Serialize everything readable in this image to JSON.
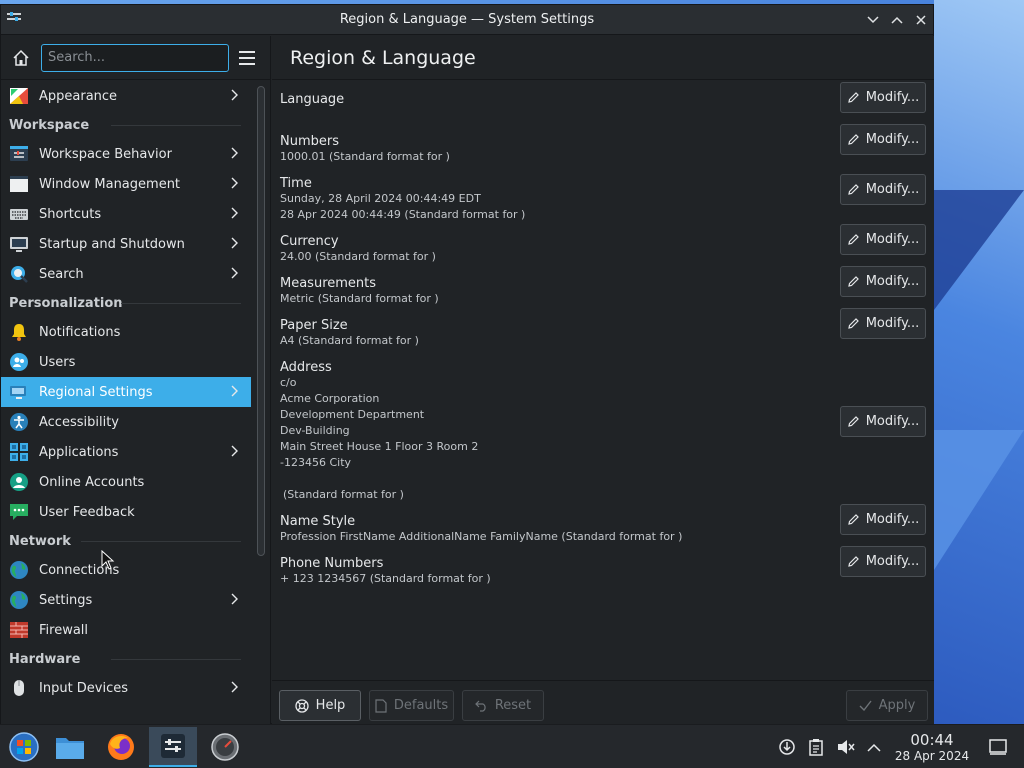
{
  "window": {
    "title": "Region & Language — System Settings"
  },
  "sidebar": {
    "search_placeholder": "Search...",
    "items": [
      {
        "type": "item",
        "label": "Appearance",
        "icon": "appearance-icon",
        "chevron": true
      },
      {
        "type": "heading",
        "label": "Workspace"
      },
      {
        "type": "item",
        "label": "Workspace Behavior",
        "icon": "workspace-behavior-icon",
        "chevron": true
      },
      {
        "type": "item",
        "label": "Window Management",
        "icon": "window-management-icon",
        "chevron": true
      },
      {
        "type": "item",
        "label": "Shortcuts",
        "icon": "keyboard-icon",
        "chevron": true
      },
      {
        "type": "item",
        "label": "Startup and Shutdown",
        "icon": "startup-icon",
        "chevron": true
      },
      {
        "type": "item",
        "label": "Search",
        "icon": "search-icon",
        "chevron": true
      },
      {
        "type": "heading",
        "label": "Personalization"
      },
      {
        "type": "item",
        "label": "Notifications",
        "icon": "bell-icon",
        "chevron": false
      },
      {
        "type": "item",
        "label": "Users",
        "icon": "users-icon",
        "chevron": false
      },
      {
        "type": "item",
        "label": "Regional Settings",
        "icon": "regional-icon",
        "chevron": true,
        "active": true
      },
      {
        "type": "item",
        "label": "Accessibility",
        "icon": "accessibility-icon",
        "chevron": false
      },
      {
        "type": "item",
        "label": "Applications",
        "icon": "applications-icon",
        "chevron": true
      },
      {
        "type": "item",
        "label": "Online Accounts",
        "icon": "online-accounts-icon",
        "chevron": false
      },
      {
        "type": "item",
        "label": "User Feedback",
        "icon": "feedback-icon",
        "chevron": false
      },
      {
        "type": "heading",
        "label": "Network"
      },
      {
        "type": "item",
        "label": "Connections",
        "icon": "globe-icon",
        "chevron": false
      },
      {
        "type": "item",
        "label": "Settings",
        "icon": "globe-icon",
        "chevron": true
      },
      {
        "type": "item",
        "label": "Firewall",
        "icon": "firewall-icon",
        "chevron": false
      },
      {
        "type": "heading",
        "label": "Hardware"
      },
      {
        "type": "item",
        "label": "Input Devices",
        "icon": "mouse-icon",
        "chevron": true
      }
    ]
  },
  "main": {
    "title": "Region & Language",
    "modify_label": "Modify...",
    "settings": [
      {
        "name": "Language",
        "values": []
      },
      {
        "name": "Numbers",
        "values": [
          "1000.01 (Standard format for )"
        ]
      },
      {
        "name": "Time",
        "values": [
          "Sunday, 28 April 2024 00:44:49 EDT",
          "28 Apr 2024 00:44:49 (Standard format for )"
        ]
      },
      {
        "name": "Currency",
        "values": [
          "24.00 (Standard format for )"
        ]
      },
      {
        "name": "Measurements",
        "values": [
          "Metric (Standard format for )"
        ]
      },
      {
        "name": "Paper Size",
        "values": [
          "A4 (Standard format for )"
        ]
      },
      {
        "name": "Address",
        "values": [
          "c/o",
          "Acme Corporation",
          "Development Department",
          "Dev-Building",
          "Main Street House 1 Floor 3 Room 2",
          "-123456 City",
          "",
          "(Standard format for )"
        ]
      },
      {
        "name": "Name Style",
        "values": [
          "Profession FirstName AdditionalName FamilyName (Standard format for )"
        ]
      },
      {
        "name": "Phone Numbers",
        "values": [
          "+ 123 1234567 (Standard format for )"
        ]
      }
    ]
  },
  "footer": {
    "help": "Help",
    "defaults": "Defaults",
    "reset": "Reset",
    "apply": "Apply"
  },
  "taskbar": {
    "time": "00:44",
    "date": "28 Apr 2024"
  },
  "colors": {
    "accent": "#3daee9",
    "window_bg": "#202326"
  }
}
